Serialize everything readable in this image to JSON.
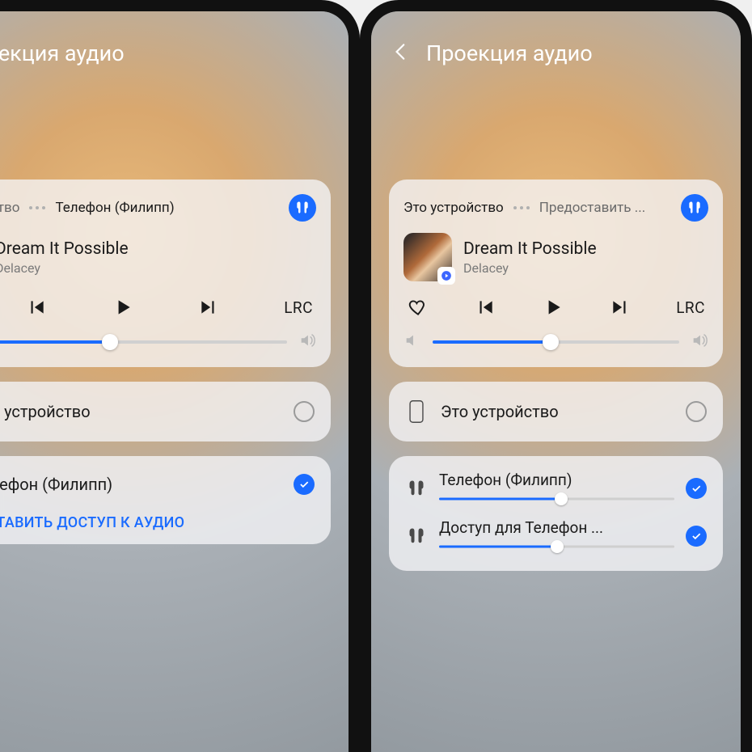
{
  "colors": {
    "accent": "#1a6bff"
  },
  "left": {
    "header": {
      "title": "Проекция аудио"
    },
    "tabs": {
      "a": "о устройство",
      "b": "Телефон (Филипп)"
    },
    "track": {
      "title": "Dream It Possible",
      "artist": "Delacey"
    },
    "lrc": "LRC",
    "volume_pct": 45,
    "device_this": "Это устройство",
    "device_phone": "Телефон (Филипп)",
    "share_link": "ПРЕДОСТАВИТЬ ДОСТУП К АУДИО"
  },
  "right": {
    "header": {
      "title": "Проекция аудио"
    },
    "tabs": {
      "a": "Это устройство",
      "b": "Предоставить ..."
    },
    "track": {
      "title": "Dream It Possible",
      "artist": "Delacey"
    },
    "lrc": "LRC",
    "volume_pct": 48,
    "device_this": "Это устройство",
    "dev1": {
      "name": "Телефон (Филипп)",
      "vol_pct": 52
    },
    "dev2": {
      "name": "Доступ для Телефон ...",
      "vol_pct": 50
    }
  }
}
